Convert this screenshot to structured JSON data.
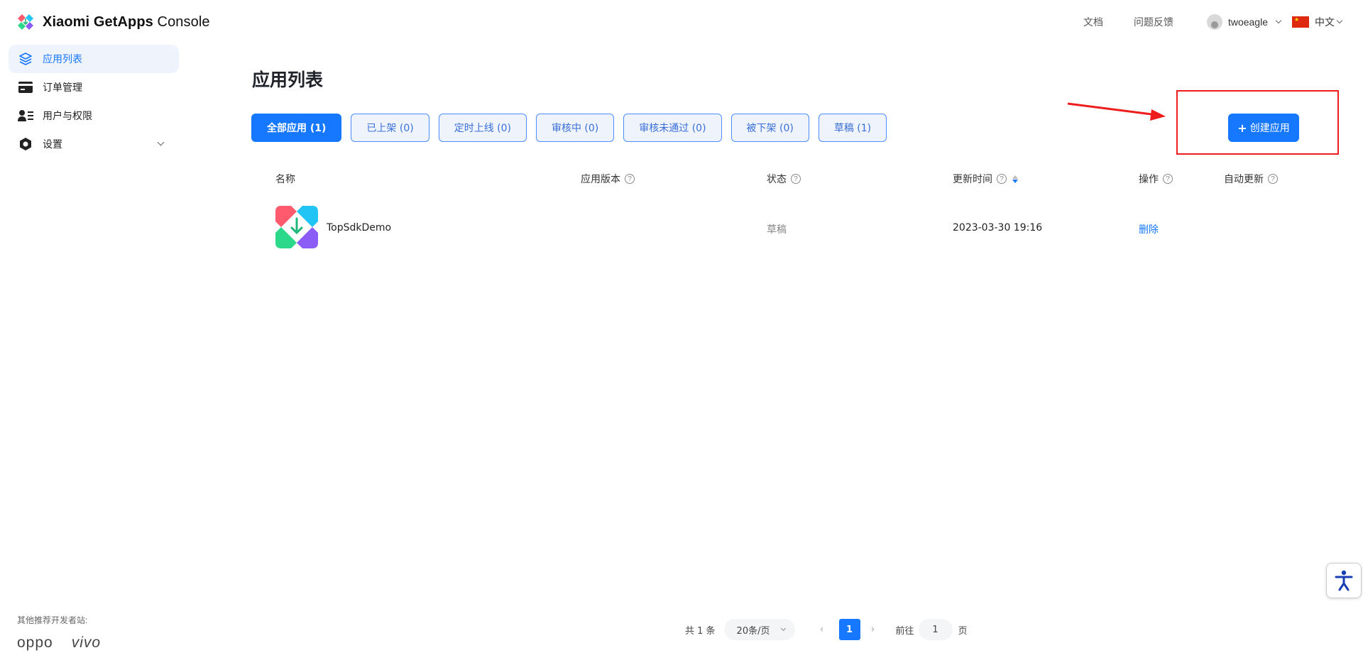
{
  "header": {
    "brand_bold": "Xiaomi GetApps",
    "brand_light": " Console",
    "docs_link": "文档",
    "feedback_link": "问题反馈",
    "username": "twoeagle",
    "language": "中文"
  },
  "sidebar": {
    "items": [
      {
        "label": "应用列表",
        "icon": "layers-icon",
        "active": true
      },
      {
        "label": "订单管理",
        "icon": "card-icon"
      },
      {
        "label": "用户与权限",
        "icon": "users-icon"
      },
      {
        "label": "设置",
        "icon": "gear-icon"
      }
    ],
    "footer_label": "其他推荐开发者站:",
    "partner_logos": [
      "oppo",
      "vivo"
    ]
  },
  "main": {
    "title": "应用列表",
    "tabs": [
      {
        "label": "全部应用 (1)",
        "active": true
      },
      {
        "label": "已上架 (0)"
      },
      {
        "label": "定时上线 (0)"
      },
      {
        "label": "审核中 (0)"
      },
      {
        "label": "审核未通过 (0)"
      },
      {
        "label": "被下架 (0)"
      },
      {
        "label": "草稿 (1)"
      }
    ],
    "create_button": "创建应用",
    "table": {
      "columns": [
        "名称",
        "应用版本",
        "状态",
        "更新时间",
        "操作",
        "自动更新"
      ],
      "rows": [
        {
          "name": "TopSdkDemo",
          "version": "",
          "status": "草稿",
          "updated": "2023-03-30 19:16",
          "action": "删除",
          "auto_update": ""
        }
      ]
    }
  },
  "pagination": {
    "total": "共 1 条",
    "page_size": "20条/页",
    "current_page": "1",
    "goto_label": "前往",
    "goto_value": "1",
    "page_suffix": "页"
  },
  "colors": {
    "primary": "#1677ff",
    "highlight": "#ee1c1c",
    "active_bg": "#eef3fc"
  }
}
